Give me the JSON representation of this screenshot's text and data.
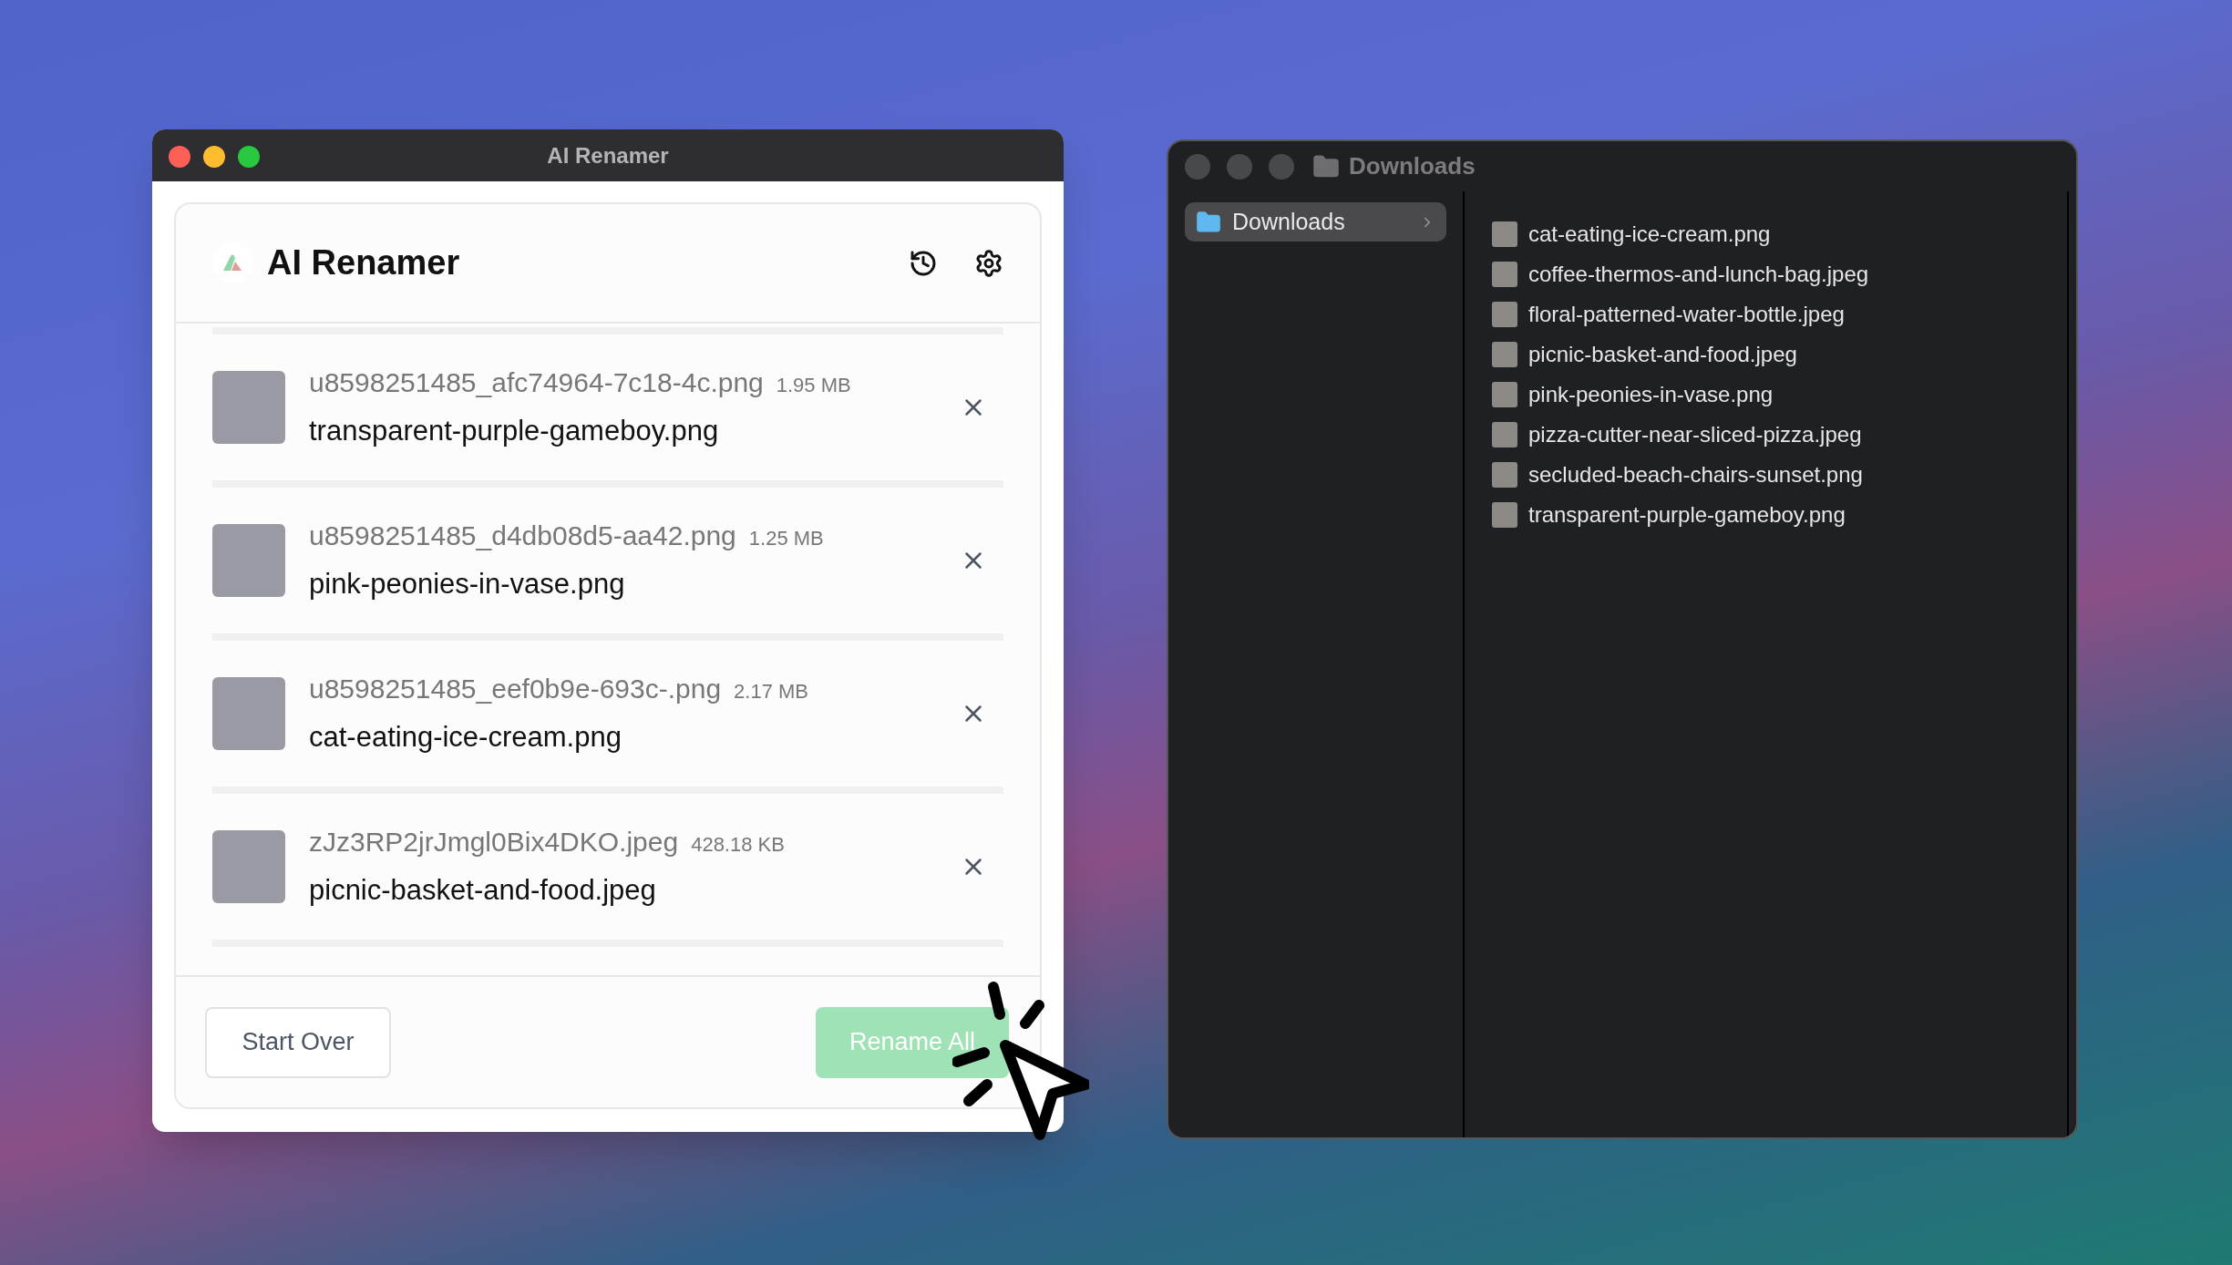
{
  "renamer_window": {
    "title": "AI Renamer",
    "app_title": "AI Renamer",
    "files": [
      {
        "original": "u8598251485_afc74964-7c18-4c.png",
        "size": "1.95 MB",
        "new_name": "transparent-purple-gameboy.png"
      },
      {
        "original": "u8598251485_d4db08d5-aa42.png",
        "size": "1.25 MB",
        "new_name": "pink-peonies-in-vase.png"
      },
      {
        "original": "u8598251485_eef0b9e-693c-.png",
        "size": "2.17 MB",
        "new_name": "cat-eating-ice-cream.png"
      },
      {
        "original": "zJz3RP2jrJmgl0Bix4DKO.jpeg",
        "size": "428.18 KB",
        "new_name": "picnic-basket-and-food.jpeg"
      }
    ],
    "start_over": "Start Over",
    "rename_all": "Rename All"
  },
  "finder_window": {
    "title": "Downloads",
    "sidebar": [
      {
        "label": "Downloads",
        "selected": true
      }
    ],
    "files": [
      "cat-eating-ice-cream.png",
      "coffee-thermos-and-lunch-bag.jpeg",
      "floral-patterned-water-bottle.jpeg",
      "picnic-basket-and-food.jpeg",
      "pink-peonies-in-vase.png",
      "pizza-cutter-near-sliced-pizza.jpeg",
      "secluded-beach-chairs-sunset.png",
      "transparent-purple-gameboy.png"
    ]
  }
}
